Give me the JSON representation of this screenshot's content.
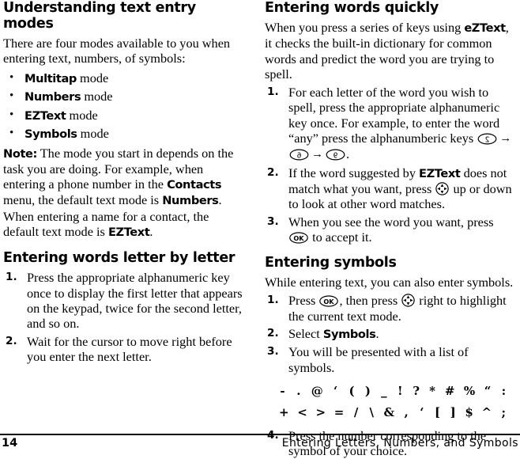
{
  "document": {
    "type": "printed-manual-page",
    "page_number": "14",
    "chapter_title": "Entering Letters, Numbers, and Symbols"
  },
  "left_column": {
    "section1": {
      "heading": "Understanding text entry modes",
      "intro": "There are four modes available to you when entering text, numbers, of symbols:",
      "bullets": [
        {
          "bold": "Multitap",
          "rest": " mode"
        },
        {
          "bold": "Numbers",
          "rest": " mode"
        },
        {
          "bold": "EZText",
          "rest": " mode"
        },
        {
          "bold": "Symbols",
          "rest": " mode"
        }
      ],
      "note_label": "Note:",
      "note_part1": " The mode you start in depends on the task you are doing. For example, when entering a phone number in the ",
      "note_bold1": "Contacts",
      "note_part2": " menu, the default text mode is ",
      "note_bold2": "Numbers",
      "note_part3": ". When entering a name for a contact, the default text mode is ",
      "note_bold3": "EZText",
      "note_part4": "."
    },
    "section2": {
      "heading": "Entering words letter by letter",
      "steps": [
        {
          "num": "1.",
          "text": "Press the appropriate alphanumeric key once to display the first letter that appears on the keypad, twice for the second letter, and so on."
        },
        {
          "num": "2.",
          "text": "Wait for the cursor to move right before you enter the next letter."
        }
      ]
    }
  },
  "right_column": {
    "section1": {
      "heading": "Entering words quickly",
      "intro_part1": "When you press a series of keys using ",
      "intro_bold": "eZText",
      "intro_part2": ", it checks the built-in dictionary for common words and predict the word you are trying to spell.",
      "steps": [
        {
          "num": "1.",
          "text_part1": "For each letter of the word you wish to spell, press the appropriate alphanumeric key once. For example, to enter the word “any” press the alphanumberic keys ",
          "keys": [
            "2",
            "6",
            "9"
          ],
          "arrow": "→",
          "text_part2": "."
        },
        {
          "num": "2.",
          "text_part1": "If the word suggested by ",
          "bold": "EZText",
          "text_part2": " does not match what you want, press ",
          "icon": "nav-pad-icon",
          "text_part3": " up or down to look at other word matches."
        },
        {
          "num": "3.",
          "text_part1": "When you see the word you want, press ",
          "icon": "ok-key-icon",
          "icon_label": "OK",
          "text_part2": " to accept it."
        }
      ]
    },
    "section2": {
      "heading": "Entering symbols",
      "intro": "While entering text, you can also enter symbols.",
      "steps": [
        {
          "num": "1.",
          "text_part1": "Press ",
          "icon1": "ok-key-icon",
          "icon1_label": "OK",
          "text_part2": ", then press ",
          "icon2": "nav-pad-icon",
          "text_part3": " right to highlight the current text mode."
        },
        {
          "num": "2.",
          "text_part1": "Select ",
          "bold": "Symbols",
          "text_part2": "."
        },
        {
          "num": "3.",
          "text_part1": "You will be presented with a list of symbols."
        },
        {
          "num": "4.",
          "text_part1": "Press the number corresponding to the symbol of your choice."
        }
      ],
      "symbol_rows": [
        [
          "-",
          ".",
          "@",
          "‘",
          "(",
          ")",
          "_",
          "!",
          "?",
          "*",
          "#",
          "%",
          "“",
          ":"
        ],
        [
          "+",
          "<",
          ">",
          "=",
          "/",
          "\\",
          "&",
          ",",
          "‘",
          "[",
          "]",
          "$",
          "^",
          ";"
        ]
      ]
    }
  }
}
